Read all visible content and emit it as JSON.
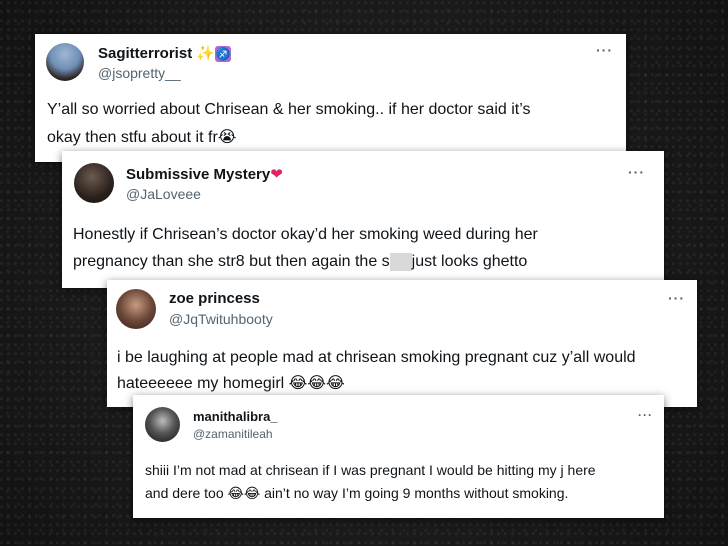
{
  "tweets": [
    {
      "name": "Sagitterrorist",
      "name_emoji": [
        "✨",
        "♐"
      ],
      "handle": "@jsopretty__",
      "more": "···",
      "line1": "Y’all so worried about Chrisean & her smoking.. if her doctor said it’s",
      "line2": "okay then stfu about it fr",
      "line2_emoji": "😭"
    },
    {
      "name": "Submissive Mystery",
      "name_emoji": "❤",
      "handle": "@JaLoveee",
      "more": "···",
      "line1": "Honestly if Chrisean’s doctor okay’d her smoking weed during her",
      "line2a": "pregnancy than she str8 but then again the s",
      "line2b": "just looks ghetto"
    },
    {
      "name": "zoe princess",
      "handle": "@JqTwituhbooty",
      "more": "···",
      "line1": "i be laughing at people mad at chrisean smoking pregnant cuz y’all would",
      "line2": "hateeeeee my homegirl",
      "line2_emoji": "😂😂😂"
    },
    {
      "name": "manithalibra_",
      "handle": "@zamanitileah",
      "more": "···",
      "line1": "shiii I’m not mad at chrisean if I was pregnant I would be hitting my j here",
      "line2a": "and dere too",
      "line2_emoji": "😂😂",
      "line2b": "ain’t no way I’m going 9 months without smoking."
    }
  ]
}
